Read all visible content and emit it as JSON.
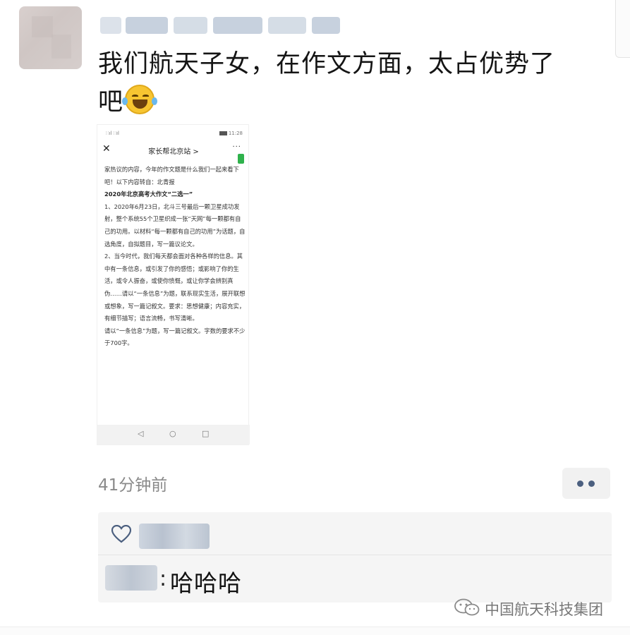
{
  "post": {
    "text_line1": "我们航天子女，在作文方面，太占优势了",
    "text_line2": "吧",
    "emoji": "laughing-tears-emoji"
  },
  "embedded_screenshot": {
    "status_time": "11:28",
    "status_signal": "∷ıl ∷ıl",
    "title": "家长帮北京站 >",
    "close_glyph": "✕",
    "more_glyph": "···",
    "paragraphs": [
      "家热议的内容，今年的作文题是什么我们一起来看下吧！以下内容转自：北青报",
      "",
      "2020年北京高考大作文“二选一”",
      "",
      "1、2020年6月23日，北斗三号最后一颗卫星成功发射，整个系统55个卫星织成一张“天网”每一颗都有自己的功用。以材料“每一颗都有自己的功用”为话题，自选角度，自拟题目，写一篇议论文。",
      "",
      "2、当今时代，我们每天都会面对各种各样的信息。其中有一条信息，或引发了你的感悟；或影响了你的生活，或令人振奋，或使你愤慨，或让你学会辨别真伪……请以“一条信息”为题，联系现实生活，展开联想或想象，写一篇记叙文。要求：思想健康；内容充实，有细节描写；语言流畅，书写清晰。",
      "请以“一条信息”为题，写一篇记叙文。字数的要求不少于700字。"
    ],
    "nav_back": "◁",
    "nav_home": "○",
    "nav_recent": "□"
  },
  "meta": {
    "timestamp": "41分钟前"
  },
  "interactions": {
    "like_icon": "heart-icon",
    "comment_colon": ":",
    "comment_text": "哈哈哈"
  },
  "watermark": {
    "text": "中国航天科技集团",
    "icon": "wechat-icon"
  }
}
